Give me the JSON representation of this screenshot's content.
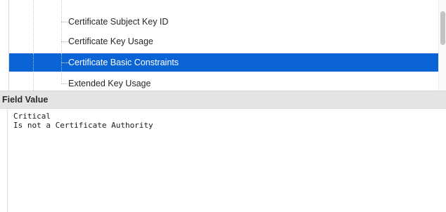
{
  "fields": {
    "items": [
      {
        "label": "Certificate Subject Key ID"
      },
      {
        "label": "Certificate Key Usage"
      },
      {
        "label": "Certificate Basic Constraints",
        "selected": true
      },
      {
        "label": "Extended Key Usage"
      }
    ]
  },
  "field_value": {
    "header": "Field Value",
    "lines": [
      "Critical",
      "Is not a Certificate Authority"
    ]
  },
  "colors": {
    "selection": "#0b64d6",
    "header_bg": "#e4e4e4"
  },
  "icons": [
    "scrollbar-thumb"
  ]
}
